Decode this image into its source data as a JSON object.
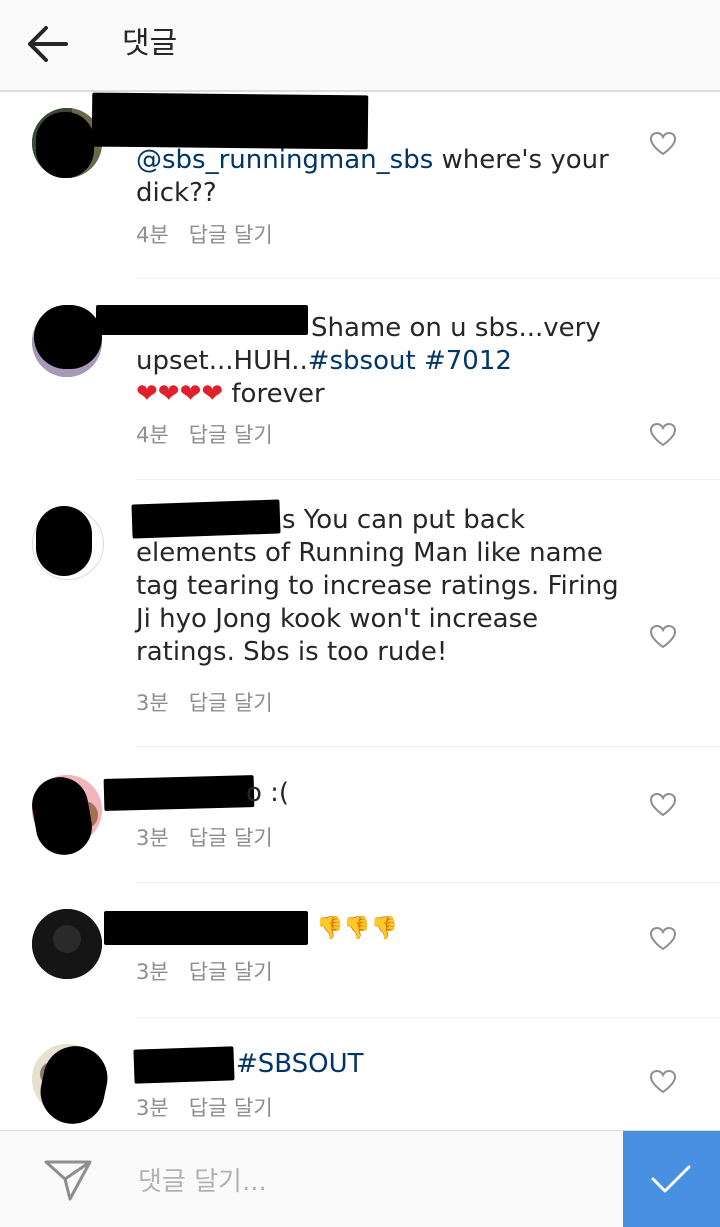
{
  "header": {
    "title": "댓글",
    "back_icon": "back-arrow-icon"
  },
  "comments": [
    {
      "mention": "@sbs_runningman_sbs",
      "text_after": " where's your dick??",
      "time": "4분",
      "reply": "답글 달기"
    },
    {
      "text_before": " Shame on u sbs...very upset...HUH..",
      "tags": "#sbsout #7012",
      "hearts": "❤❤❤❤",
      "text_after": " forever",
      "time": "4분",
      "reply": "답글 달기"
    },
    {
      "visible_fragment": "s",
      "text": " You can put back elements of Running Man like name tag tearing to increase ratings. Firing Ji hyo Jong kook won't increase ratings. Sbs is too rude!",
      "time": "3분",
      "reply": "답글 달기"
    },
    {
      "text": "o :(",
      "time": "3분",
      "reply": "답글 달기"
    },
    {
      "emoji": "👎👎👎",
      "time": "3분",
      "reply": "답글 달기"
    },
    {
      "tags": "#SBSOUT",
      "time": "3분",
      "reply": "답글 달기"
    }
  ],
  "footer": {
    "placeholder": "댓글 달기...",
    "send_icon": "paper-plane-icon",
    "post_icon": "checkmark-icon"
  },
  "colors": {
    "accent": "#4a90e2",
    "link": "#003569",
    "meta": "#8e8e8e"
  }
}
